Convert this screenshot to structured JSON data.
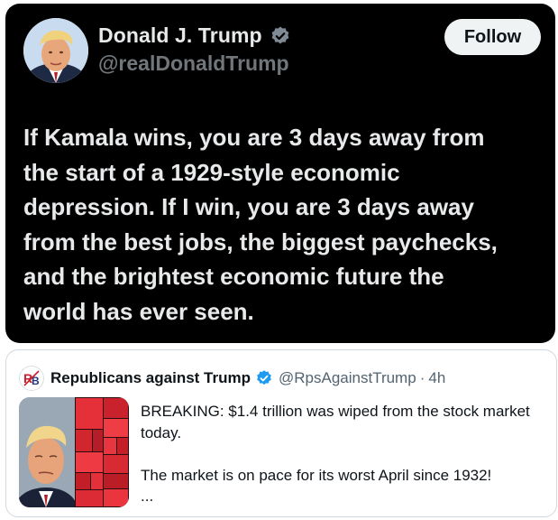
{
  "tweet": {
    "author": {
      "display_name": "Donald J. Trump",
      "handle": "@realDonaldTrump",
      "verified_icon": "verified-badge-icon",
      "avatar_icon": "profile-photo"
    },
    "follow_label": "Follow",
    "text_lines": [
      "If Kamala wins, you are 3 days away from",
      "the start of a 1929-style economic",
      "depression. If I win, you are 3 days away",
      "from the best jobs, the biggest paychecks,",
      "and the brightest economic future the",
      "world has ever seen."
    ]
  },
  "quote": {
    "author": {
      "display_name": "Republicans against Trump",
      "handle": "@RpsAgainstTrump",
      "separator": "·",
      "time": "4h",
      "avatar_icon": "rpt-logo"
    },
    "media_icon": "trump-and-stock-heatmap-photo",
    "text": {
      "line1": "BREAKING: $1.4 trillion was wiped from the stock market today.",
      "line2": "The market is on pace for its worst April since 1932!",
      "more": "..."
    }
  },
  "colors": {
    "dark_bg": "#000000",
    "dark_text": "#e7e9ea",
    "muted": "#71767b",
    "verified_blue": "#1d9bf0",
    "heatmap_red": "#e5303a"
  }
}
